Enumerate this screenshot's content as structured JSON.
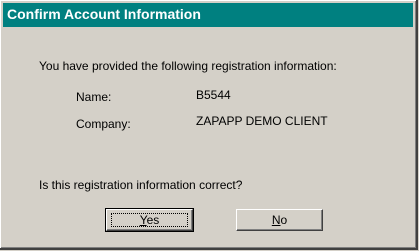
{
  "dialog": {
    "title": "Confirm Account Information",
    "intro": "You have provided the following registration information:",
    "fields": [
      {
        "label": "Name:",
        "value": "B5544"
      },
      {
        "label": "Company:",
        "value": "ZAPAPP DEMO CLIENT"
      }
    ],
    "question": "Is this registration information correct?",
    "yes_button": {
      "mnemonic": "Y",
      "rest": "es"
    },
    "no_button": {
      "mnemonic": "N",
      "rest": "o"
    }
  },
  "colors": {
    "titlebar": "#008080",
    "dialog_face": "#d4d0c8"
  }
}
